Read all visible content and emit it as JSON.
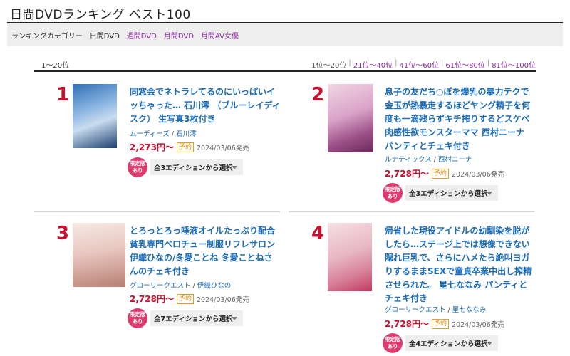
{
  "page": {
    "title": "日間DVDランキング ベスト100"
  },
  "category": {
    "label": "ランキングカテゴリー",
    "current": "日間DVD",
    "links": [
      "週間DVD",
      "月間DVD",
      "月間AV女優"
    ]
  },
  "range_label": "1〜20位",
  "pager": [
    "1位〜20位",
    "21位〜40位",
    "41位〜60位",
    "61位〜80位",
    "81位〜100位"
  ],
  "items": [
    {
      "rank": "1",
      "title": "同窓会でネトラレてるのにいっぱいイッちゃった… 石川澪 （ブルーレイディスク） 生写真3枚付き",
      "maker": "ムーディーズ",
      "actress": "石川澪",
      "price": "2,273円〜",
      "badge": "予約",
      "date": "2024/03/06発売",
      "limited": "限定版あり",
      "edition": "全3エディションから選択",
      "thumb_colors": [
        "#2f6fb5",
        "#c9dcf0",
        "#1b3f6e"
      ]
    },
    {
      "rank": "2",
      "title": "息子の友だち○ぽを爆乳の暴力テクで金玉が熱暴走するほどヤング精子を何度も一滴残らずキチ搾りするどスケベ肉感性欲モンスターママ 西村ニーナ パンティとチェキ付き",
      "maker": "ルナティックス",
      "actress": "西村ニーナ",
      "price": "2,728円〜",
      "badge": "予約",
      "date": "2024/03/06発売",
      "limited": "限定版あり",
      "edition": "全3エディションから選択",
      "thumb_colors": [
        "#d9a3c8",
        "#f0d6e3",
        "#6a2a5a"
      ]
    },
    {
      "rank": "3",
      "title": "とろっとろっ唾液オイルたっぷり配合 貧乳専門ベロチュー制服リフレサロン 伊織ひなの/冬愛ことね 冬愛ことねさんのチェキ付き",
      "maker": "グローリークエスト",
      "actress": "伊織ひなの",
      "price": "2,728円〜",
      "badge": "予約",
      "date": "2024/03/06発売",
      "limited": "限定版あり",
      "edition": "全7エディションから選択",
      "thumb_colors": [
        "#e8c7c0",
        "#f6e9e4",
        "#b67f74"
      ]
    },
    {
      "rank": "4",
      "title": "帰省した現役アイドルの幼馴染を脱がしたら…ステージ上では想像できない隠れ巨乳で、さらにハメたら絶叫ヨガりするままSEXで童貞卒業中出し搾精させられた。 星七ななみ パンティとチェキ付き",
      "maker": "グローリークエスト",
      "actress": "星七ななみ",
      "price": "2,728円〜",
      "badge": "予約",
      "date": "2024/03/06発売",
      "limited": "限定版あり",
      "edition": "全4エディションから選択",
      "thumb_colors": [
        "#e8b7c4",
        "#f5dfe4",
        "#c23a5e"
      ]
    }
  ]
}
